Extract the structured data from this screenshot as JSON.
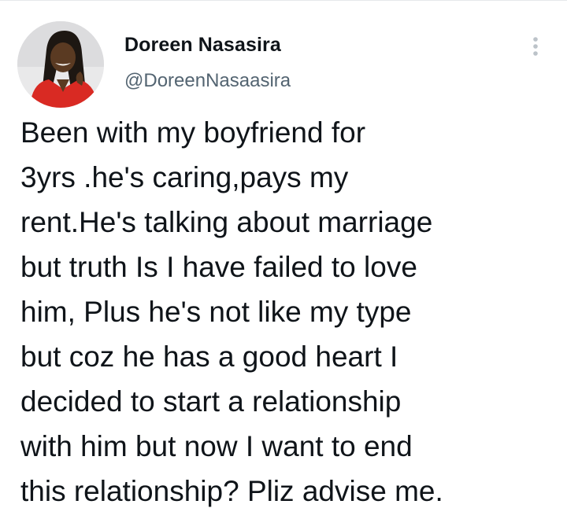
{
  "author": {
    "display_name": "Doreen Nasasira",
    "handle": "@DoreenNasaasira"
  },
  "more_icon": "more-vertical-icon",
  "tweet": {
    "lines": [
      "Been with my boyfriend for",
      "3yrs .he's caring,pays my",
      "rent.He's talking about marriage",
      "but truth Is I have failed to love",
      "him, Plus he's not like my type",
      "but coz he has a good heart I",
      "decided to start a relationship",
      "with him but now I want to end",
      "this relationship? Pliz advise me."
    ]
  },
  "colors": {
    "text": "#0f1419",
    "secondary": "#536471",
    "icon": "#bcc3c9"
  }
}
